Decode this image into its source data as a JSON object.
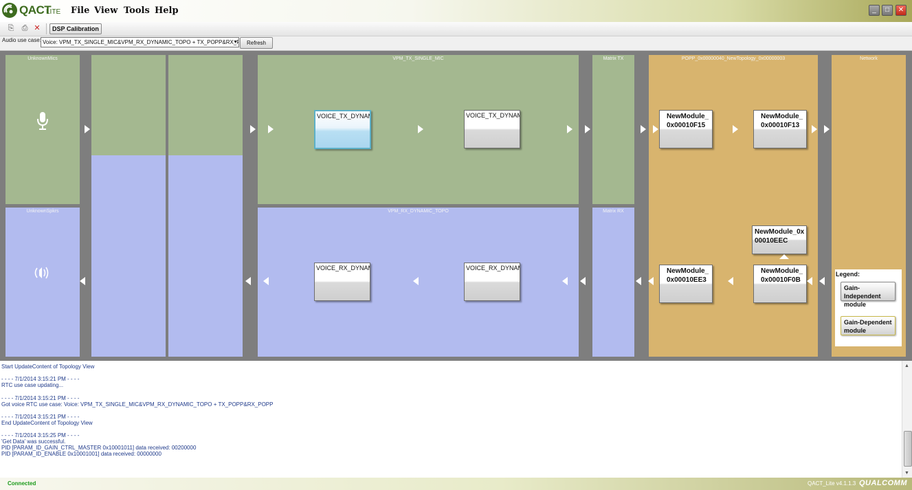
{
  "app": {
    "name": "QACT",
    "edition": "LITE"
  },
  "menu": [
    "File",
    "View",
    "Tools",
    "Help"
  ],
  "window_controls": {
    "minimize": "_",
    "maximize": "□",
    "close": "✕"
  },
  "toolbar": {
    "dsp_button": "DSP Calibration",
    "icons": [
      "connect-icon",
      "disconnect-icon",
      "remove-icon"
    ]
  },
  "usecase": {
    "label": "Audio use case:",
    "value": "Voice: VPM_TX_SINGLE_MIC&VPM_RX_DYNAMIC_TOPO + TX_POPP&RX_PO",
    "refresh": "Refresh"
  },
  "panels": {
    "unknown_mics": "UnknownMics",
    "unknown_spkrs": "UnknownSpkrs",
    "vpm_tx": "VPM_TX_SINGLE_MIC",
    "vpm_rx": "VPM_RX_DYNAMIC_TOPO",
    "matrix_tx": "Matrix TX",
    "matrix_rx": "Matrix RX",
    "popp": "POPP_0x00000040_NewTopology_0x00000003",
    "network": "Network"
  },
  "modules": {
    "voice_tx_1": "VOICE_TX_DYNAMIC_",
    "voice_tx_2": "VOICE_TX_DYNAMIC_",
    "voice_rx_1": "VOICE_RX_DYNAMIC",
    "voice_rx_2": "VOICE_RX_DYNAMIC",
    "popp_tx_1": "NewModule_0x00010F15",
    "popp_tx_2": "NewModule_0x00010F13",
    "popp_mid": "NewModule_0x00010EEC",
    "popp_rx_1": "NewModule_0x00010EE3",
    "popp_rx_2": "NewModule_0x00010F0B"
  },
  "legend": {
    "title": "Legend:",
    "gain_independent": "Gain-Independent module",
    "gain_dependent": "Gain-Dependent module"
  },
  "log": [
    "Start UpdateContent of Topology View",
    "",
    "- - - - 7/1/2014 3:15:21 PM - - - -",
    "RTC use case updating...",
    "",
    "- - - - 7/1/2014 3:15:21 PM - - - -",
    "Got voice RTC use case: Voice: VPM_TX_SINGLE_MIC&VPM_RX_DYNAMIC_TOPO + TX_POPP&RX_POPP",
    "",
    "- - - - 7/1/2014 3:15:21 PM - - - -",
    "End UpdateContent of Topology View",
    "",
    "- - - - 7/1/2014 3:15:25 PM - - - -",
    "'Get Data' was successful.",
    "PID [PARAM_ID_GAIN_CTRL_MASTER 0x10001011] data received: 00200000",
    "PID [PARAM_ID_ENABLE 0x10001001] data received: 00000000"
  ],
  "status": {
    "connection": "Connected",
    "version": "QACT_Lite v4.1.1.3",
    "brand": "QUALCOMM"
  },
  "colors": {
    "tx_panel": "#a4b890",
    "rx_panel": "#b2bbef",
    "popp_panel": "#d8b46e",
    "selected_module": "#aad6ef"
  }
}
